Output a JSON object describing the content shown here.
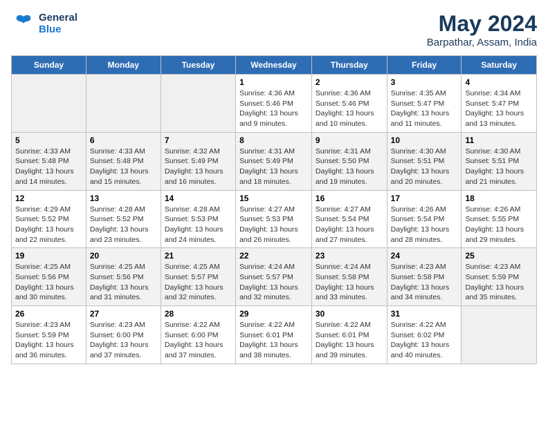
{
  "header": {
    "logo_line1": "General",
    "logo_line2": "Blue",
    "month_year": "May 2024",
    "location": "Barpathar, Assam, India"
  },
  "days_of_week": [
    "Sunday",
    "Monday",
    "Tuesday",
    "Wednesday",
    "Thursday",
    "Friday",
    "Saturday"
  ],
  "weeks": [
    [
      {
        "day": "",
        "info": ""
      },
      {
        "day": "",
        "info": ""
      },
      {
        "day": "",
        "info": ""
      },
      {
        "day": "1",
        "info": "Sunrise: 4:36 AM\nSunset: 5:46 PM\nDaylight: 13 hours\nand 9 minutes."
      },
      {
        "day": "2",
        "info": "Sunrise: 4:36 AM\nSunset: 5:46 PM\nDaylight: 13 hours\nand 10 minutes."
      },
      {
        "day": "3",
        "info": "Sunrise: 4:35 AM\nSunset: 5:47 PM\nDaylight: 13 hours\nand 11 minutes."
      },
      {
        "day": "4",
        "info": "Sunrise: 4:34 AM\nSunset: 5:47 PM\nDaylight: 13 hours\nand 13 minutes."
      }
    ],
    [
      {
        "day": "5",
        "info": "Sunrise: 4:33 AM\nSunset: 5:48 PM\nDaylight: 13 hours\nand 14 minutes."
      },
      {
        "day": "6",
        "info": "Sunrise: 4:33 AM\nSunset: 5:48 PM\nDaylight: 13 hours\nand 15 minutes."
      },
      {
        "day": "7",
        "info": "Sunrise: 4:32 AM\nSunset: 5:49 PM\nDaylight: 13 hours\nand 16 minutes."
      },
      {
        "day": "8",
        "info": "Sunrise: 4:31 AM\nSunset: 5:49 PM\nDaylight: 13 hours\nand 18 minutes."
      },
      {
        "day": "9",
        "info": "Sunrise: 4:31 AM\nSunset: 5:50 PM\nDaylight: 13 hours\nand 19 minutes."
      },
      {
        "day": "10",
        "info": "Sunrise: 4:30 AM\nSunset: 5:51 PM\nDaylight: 13 hours\nand 20 minutes."
      },
      {
        "day": "11",
        "info": "Sunrise: 4:30 AM\nSunset: 5:51 PM\nDaylight: 13 hours\nand 21 minutes."
      }
    ],
    [
      {
        "day": "12",
        "info": "Sunrise: 4:29 AM\nSunset: 5:52 PM\nDaylight: 13 hours\nand 22 minutes."
      },
      {
        "day": "13",
        "info": "Sunrise: 4:28 AM\nSunset: 5:52 PM\nDaylight: 13 hours\nand 23 minutes."
      },
      {
        "day": "14",
        "info": "Sunrise: 4:28 AM\nSunset: 5:53 PM\nDaylight: 13 hours\nand 24 minutes."
      },
      {
        "day": "15",
        "info": "Sunrise: 4:27 AM\nSunset: 5:53 PM\nDaylight: 13 hours\nand 26 minutes."
      },
      {
        "day": "16",
        "info": "Sunrise: 4:27 AM\nSunset: 5:54 PM\nDaylight: 13 hours\nand 27 minutes."
      },
      {
        "day": "17",
        "info": "Sunrise: 4:26 AM\nSunset: 5:54 PM\nDaylight: 13 hours\nand 28 minutes."
      },
      {
        "day": "18",
        "info": "Sunrise: 4:26 AM\nSunset: 5:55 PM\nDaylight: 13 hours\nand 29 minutes."
      }
    ],
    [
      {
        "day": "19",
        "info": "Sunrise: 4:25 AM\nSunset: 5:56 PM\nDaylight: 13 hours\nand 30 minutes."
      },
      {
        "day": "20",
        "info": "Sunrise: 4:25 AM\nSunset: 5:56 PM\nDaylight: 13 hours\nand 31 minutes."
      },
      {
        "day": "21",
        "info": "Sunrise: 4:25 AM\nSunset: 5:57 PM\nDaylight: 13 hours\nand 32 minutes."
      },
      {
        "day": "22",
        "info": "Sunrise: 4:24 AM\nSunset: 5:57 PM\nDaylight: 13 hours\nand 32 minutes."
      },
      {
        "day": "23",
        "info": "Sunrise: 4:24 AM\nSunset: 5:58 PM\nDaylight: 13 hours\nand 33 minutes."
      },
      {
        "day": "24",
        "info": "Sunrise: 4:23 AM\nSunset: 5:58 PM\nDaylight: 13 hours\nand 34 minutes."
      },
      {
        "day": "25",
        "info": "Sunrise: 4:23 AM\nSunset: 5:59 PM\nDaylight: 13 hours\nand 35 minutes."
      }
    ],
    [
      {
        "day": "26",
        "info": "Sunrise: 4:23 AM\nSunset: 5:59 PM\nDaylight: 13 hours\nand 36 minutes."
      },
      {
        "day": "27",
        "info": "Sunrise: 4:23 AM\nSunset: 6:00 PM\nDaylight: 13 hours\nand 37 minutes."
      },
      {
        "day": "28",
        "info": "Sunrise: 4:22 AM\nSunset: 6:00 PM\nDaylight: 13 hours\nand 37 minutes."
      },
      {
        "day": "29",
        "info": "Sunrise: 4:22 AM\nSunset: 6:01 PM\nDaylight: 13 hours\nand 38 minutes."
      },
      {
        "day": "30",
        "info": "Sunrise: 4:22 AM\nSunset: 6:01 PM\nDaylight: 13 hours\nand 39 minutes."
      },
      {
        "day": "31",
        "info": "Sunrise: 4:22 AM\nSunset: 6:02 PM\nDaylight: 13 hours\nand 40 minutes."
      },
      {
        "day": "",
        "info": ""
      }
    ]
  ]
}
